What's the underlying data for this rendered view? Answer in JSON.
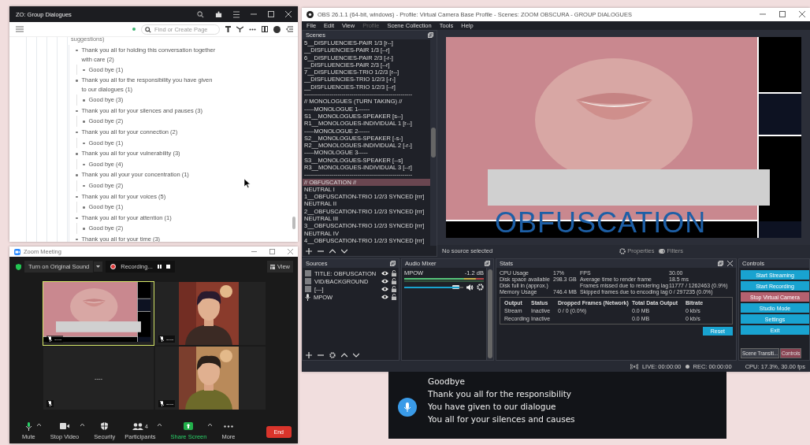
{
  "roam": {
    "title": "ZO: Group Dialogues",
    "search": {
      "placeholder": "Find or Create Page"
    },
    "outline": [
      {
        "text": "suggestions)",
        "children": [
          {
            "text": "Thank you all for holding this conversation together with care (2)",
            "children": [
              {
                "text": "Good bye (1)"
              }
            ]
          },
          {
            "text": "Thank you all for the responsibility you have given to our dialogues (1)",
            "children": [
              {
                "text": "Good bye (3)"
              }
            ]
          },
          {
            "text": "Thank you all for your silences and pauses (3)",
            "children": [
              {
                "text": "Good bye (2)"
              }
            ]
          },
          {
            "text": "Thank you all for your connection (2)",
            "children": [
              {
                "text": "Good bye (1)"
              }
            ]
          },
          {
            "text": "Thank you all for your vulnerability (3)",
            "children": [
              {
                "text": "Good bye (4)"
              }
            ]
          },
          {
            "text": "Thank you all your your concentration (1)",
            "children": [
              {
                "text": "Good bye (2)"
              }
            ]
          },
          {
            "text": "Thank you all for your voices (5)",
            "children": [
              {
                "text": "Good bye (1)"
              }
            ]
          },
          {
            "text": "Thank you all for your attention (1)",
            "children": [
              {
                "text": "Good bye (2)"
              }
            ]
          },
          {
            "text": "Thank you all for your time (3)"
          }
        ]
      }
    ]
  },
  "obs": {
    "title": "OBS 26.1.1 (64-bit, windows) - Profile: Virtual Camera Base Profile - Scenes: ZOOM OBSCURA - GROUP DIALOGUES",
    "menu": [
      {
        "label": "File",
        "disabled": false
      },
      {
        "label": "Edit",
        "disabled": false
      },
      {
        "label": "View",
        "disabled": false
      },
      {
        "label": "Profile",
        "disabled": true
      },
      {
        "label": "Scene Collection",
        "disabled": false
      },
      {
        "label": "Tools",
        "disabled": false
      },
      {
        "label": "Help",
        "disabled": false
      }
    ],
    "scenes": {
      "title": "Scenes",
      "items": [
        {
          "label": "5__DISFLUENCIES-PAIR 1/3 [r--]",
          "selected": false
        },
        {
          "label": "__DISFLUENCIES-PAIR 1/3 [--r]",
          "selected": false
        },
        {
          "label": "6__DISFLUENCIES-PAIR 2/3 [-r-]",
          "selected": false
        },
        {
          "label": "__DISFLUENCIES-PAIR 2/3 [--r]",
          "selected": false
        },
        {
          "label": "7__DISFLUENCIES-TRIO 1/2/3 [r--]",
          "selected": false
        },
        {
          "label": "__DISFLUENCIES-TRIO 1/2/3 [-r-]",
          "selected": false
        },
        {
          "label": "__DISFLUENCIES-TRIO 1/2/3 [--r]",
          "selected": false
        },
        {
          "label": "-------------------------------------------------------",
          "selected": false
        },
        {
          "label": "// MONOLOGUES (TURN TAKING) //",
          "selected": false
        },
        {
          "label": "-----MONOLOGUE 1------",
          "selected": false
        },
        {
          "label": "S1__MONOLOGUES-SPEAKER [s--]",
          "selected": false
        },
        {
          "label": "R1__MONOLOGUES-INDIVIDUAL 1 [r--]",
          "selected": false
        },
        {
          "label": "-----MONOLOGUE 2------",
          "selected": false
        },
        {
          "label": "S2__MONOLOGUES-SPEAKER [-s-]",
          "selected": false
        },
        {
          "label": "R2__MONOLOGUES-INDIVIDUAL 2 [-r-]",
          "selected": false
        },
        {
          "label": "-----MONOLOGUE 3-----",
          "selected": false
        },
        {
          "label": "S3__MONOLOGUES-SPEAKER [--s]",
          "selected": false
        },
        {
          "label": "R3__MONOLOGUES-INDIVIDUAL 3 [--r]",
          "selected": false
        },
        {
          "label": "-------------------------------------------------------",
          "selected": false
        },
        {
          "label": "// OBFUSCATION //",
          "selected": true
        },
        {
          "label": "NEUTRAL I",
          "selected": false
        },
        {
          "label": "1__OBFUSCATION-TRIO 1/2/3 SYNCED [rrr]",
          "selected": false
        },
        {
          "label": "NEUTRAL II",
          "selected": false
        },
        {
          "label": "2__OBFUSCATION-TRIO 1/2/3 SYNCED [rrr]",
          "selected": false
        },
        {
          "label": "NEUTRAL III",
          "selected": false
        },
        {
          "label": "3__OBFUSCATION-TRIO 1/2/3 SYNCED [rrr]",
          "selected": false
        },
        {
          "label": "NEUTRAL IV",
          "selected": false
        },
        {
          "label": "4__OBFUSCATION-TRIO 1/2/3 SYNCED [rrr]",
          "selected": false
        }
      ]
    },
    "preview": {
      "overlay_text": "OBFUSCATION",
      "status": "No source selected",
      "buttons": [
        "Properties",
        "Filters"
      ]
    },
    "sources": {
      "title": "Sources",
      "items": [
        {
          "label": "TITLE: OBFUSCATION",
          "kind": "text"
        },
        {
          "label": "VID/BACKGROUND",
          "kind": "text"
        },
        {
          "label": "[---]",
          "kind": "text"
        },
        {
          "label": "MPOW",
          "kind": "audio"
        }
      ]
    },
    "audio_mixer": {
      "title": "Audio Mixer",
      "channels": [
        {
          "name": "MPOW",
          "reading": "-1.2 dB",
          "level": 0.93
        }
      ]
    },
    "stats": {
      "title": "Stats",
      "metrics": [
        {
          "label": "CPU Usage",
          "value": "17%"
        },
        {
          "label": "FPS",
          "value": "30.00"
        },
        {
          "label": "Disk space available",
          "value": "298.3 GB"
        },
        {
          "label": "Average time to render frame",
          "value": "18.5 ms"
        },
        {
          "label": "Disk full in (approx.)"
        },
        {
          "label": "Frames missed due to rendering lag",
          "value": "11777 / 1262463 (0.9%)"
        },
        {
          "label": "Memory Usage",
          "value": "746.4 MB"
        },
        {
          "label": "Skipped frames due to encoding lag",
          "value": "0 / 297235 (0.0%)"
        }
      ],
      "table": {
        "columns": [
          "Output",
          "Status",
          "Dropped Frames (Network)",
          "Total Data Output",
          "Bitrate"
        ],
        "rows": [
          [
            "Stream",
            "Inactive",
            "0 / 0 (0.0%)",
            "0.0 MB",
            "0 kb/s"
          ],
          [
            "Recording",
            "Inactive",
            null,
            "0.0 MB",
            "0 kb/s"
          ]
        ]
      },
      "reset": "Reset"
    },
    "controls": {
      "title": "Controls",
      "buttons": [
        {
          "label": "Start Streaming",
          "active": false
        },
        {
          "label": "Start Recording",
          "active": false
        },
        {
          "label": "Stop Virtual Camera",
          "active": true
        },
        {
          "label": "Studio Mode",
          "active": false
        },
        {
          "label": "Settings",
          "active": false
        },
        {
          "label": "Exit",
          "active": false
        }
      ]
    },
    "dock_tabs": [
      {
        "label": "Scene Transiti...",
        "selected": false
      },
      {
        "label": "Controls",
        "selected": true
      }
    ],
    "status_bar": {
      "live": "LIVE: 00:00:00",
      "rec": "REC: 00:00:00",
      "cpu": "CPU: 17.3%, 30.00 fps"
    }
  },
  "zoom": {
    "title": "Zoom Meeting",
    "original_sound": "Turn on Original Sound",
    "recording": "Recording...",
    "view": "View",
    "tiles": [
      {
        "kind": "screen",
        "name": "----",
        "active": true
      },
      {
        "kind": "camera",
        "name": "----",
        "active": false
      },
      {
        "kind": "empty",
        "center": "----",
        "active": false
      },
      {
        "kind": "camera",
        "name": "----",
        "active": false
      }
    ],
    "toolbar": [
      {
        "kind": "mic",
        "label": "Mute"
      },
      {
        "kind": "video",
        "label": "Stop Video"
      },
      {
        "kind": "security",
        "label": "Security"
      },
      {
        "kind": "participants",
        "label": "Participants",
        "count": "4"
      },
      {
        "kind": "share",
        "label": "Share Screen"
      },
      {
        "kind": "more",
        "label": "More"
      }
    ],
    "end": "End"
  },
  "captions": {
    "lines": [
      "Goodbye",
      "Thank you all for the responsibility",
      "You have given to our dialogue",
      "You all for your silences and causes"
    ]
  }
}
